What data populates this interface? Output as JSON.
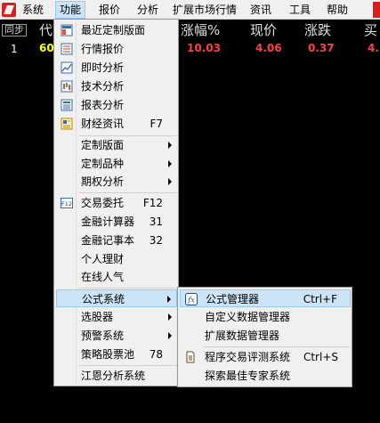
{
  "menubar": {
    "items": [
      "系统",
      "功能",
      "报价",
      "分析",
      "扩展市场行情",
      "资讯",
      "工具",
      "帮助"
    ]
  },
  "table": {
    "left_tab": "同步",
    "headers": {
      "code": "代",
      "change_pct": "涨幅%",
      "price": "现价",
      "change": "涨跌",
      "buy": "买"
    },
    "rows": [
      {
        "num": "1",
        "code": "60",
        "change_pct": "10.03",
        "price": "4.06",
        "change": "0.37",
        "buy": "4."
      }
    ]
  },
  "function_menu": {
    "items": [
      {
        "label": "最近定制版面",
        "shortcut": "",
        "icon": "layout-icon"
      },
      {
        "label": "行情报价",
        "shortcut": "",
        "icon": "quote-list-icon"
      },
      {
        "label": "即时分析",
        "shortcut": "",
        "icon": "line-chart-icon"
      },
      {
        "label": "技术分析",
        "shortcut": "",
        "icon": "candlestick-icon"
      },
      {
        "label": "报表分析",
        "shortcut": "",
        "icon": "report-icon"
      },
      {
        "label": "财经资讯",
        "shortcut": "F7",
        "icon": "news-icon"
      },
      {
        "label": "定制版面",
        "shortcut": "",
        "submenu": true
      },
      {
        "label": "定制品种",
        "shortcut": "",
        "submenu": true
      },
      {
        "label": "期权分析",
        "shortcut": "",
        "submenu": true
      },
      {
        "label": "交易委托",
        "shortcut": "F12",
        "icon": "trade-icon",
        "icon_text": "F12"
      },
      {
        "label": "金融计算器",
        "shortcut": "31"
      },
      {
        "label": "金融记事本",
        "shortcut": "32"
      },
      {
        "label": "个人理财",
        "shortcut": ""
      },
      {
        "label": "在线人气",
        "shortcut": ""
      },
      {
        "label": "公式系统",
        "shortcut": "",
        "submenu": true,
        "active": true
      },
      {
        "label": "选股器",
        "shortcut": "",
        "submenu": true
      },
      {
        "label": "预警系统",
        "shortcut": "",
        "submenu": true
      },
      {
        "label": "策略股票池",
        "shortcut": "78"
      },
      {
        "label": "江恩分析系统",
        "shortcut": ""
      }
    ]
  },
  "formula_submenu": {
    "items": [
      {
        "label": "公式管理器",
        "shortcut": "Ctrl+F",
        "icon": "formula-icon",
        "icon_text": "fx",
        "active": true
      },
      {
        "label": "自定义数据管理器",
        "shortcut": ""
      },
      {
        "label": "扩展数据管理器",
        "shortcut": ""
      },
      {
        "label": "程序交易评测系统",
        "shortcut": "Ctrl+S",
        "icon": "document-icon"
      },
      {
        "label": "探索最佳专家系统",
        "shortcut": ""
      }
    ]
  },
  "colors": {
    "background": "#000000",
    "menu_bg": "#f0f0f0",
    "highlight": "#cce4f7",
    "highlight_border": "#99c9ef",
    "up_red": "#ff4040",
    "code_yellow": "#ffff00"
  }
}
